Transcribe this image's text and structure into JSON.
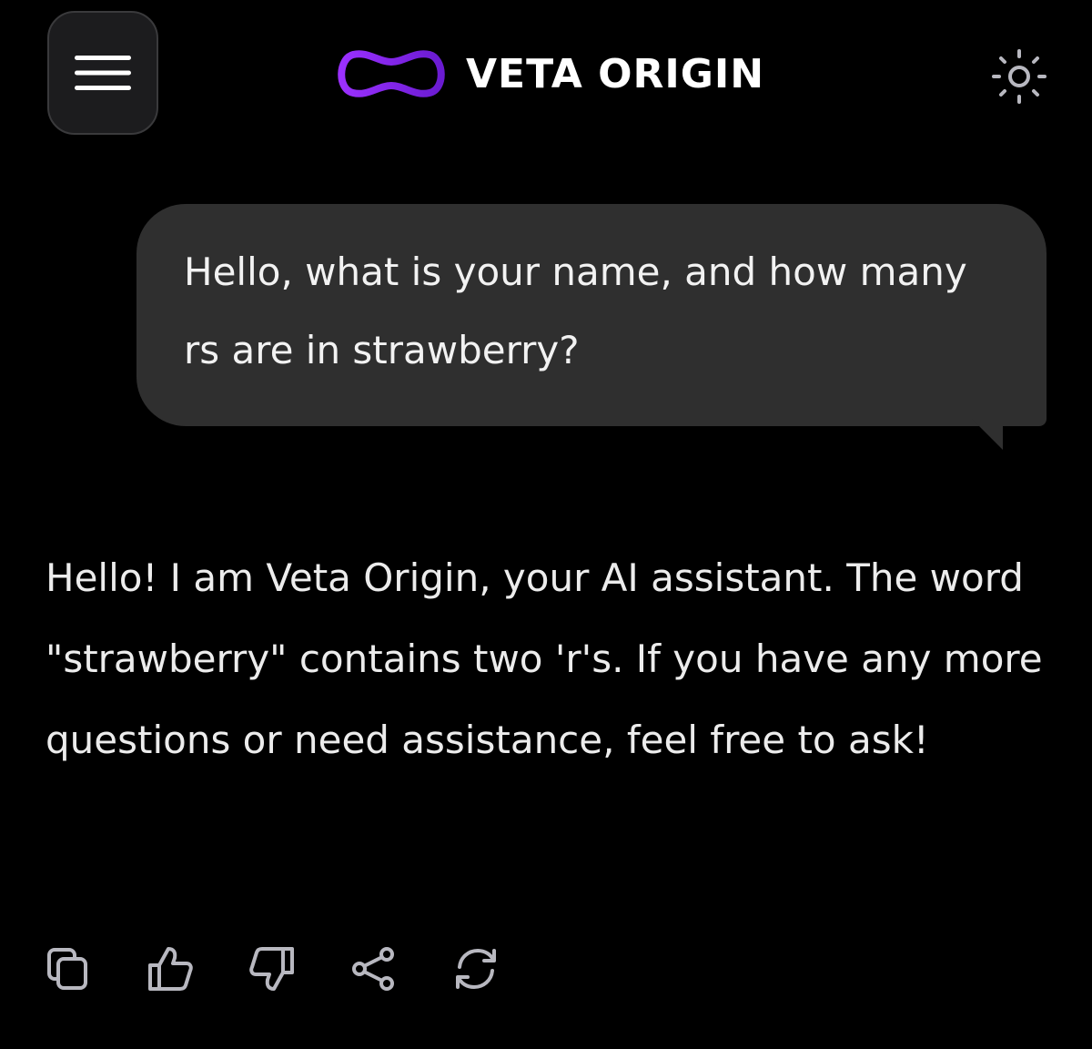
{
  "header": {
    "menu_icon": "hamburger-menu-icon",
    "brand_name": "VETA ORIGIN",
    "brand_logo": "veta-origin-logo",
    "theme_icon": "sun-icon"
  },
  "conversation": {
    "user_message": "Hello, what is your name, and how many rs are in strawberry?",
    "assistant_message": "Hello! I am Veta Origin, your AI assistant. The word \"strawberry\" contains two 'r's. If you have any more questions or need assistance, feel free to ask!"
  },
  "actions": [
    {
      "icon": "copy-icon"
    },
    {
      "icon": "thumbs-up-icon"
    },
    {
      "icon": "thumbs-down-icon"
    },
    {
      "icon": "share-icon"
    },
    {
      "icon": "regenerate-icon"
    }
  ],
  "colors": {
    "background": "#000000",
    "bubble": "#2f2f2f",
    "accent_purple": "#8a2be2",
    "icon_gray": "#b8b8c0"
  }
}
